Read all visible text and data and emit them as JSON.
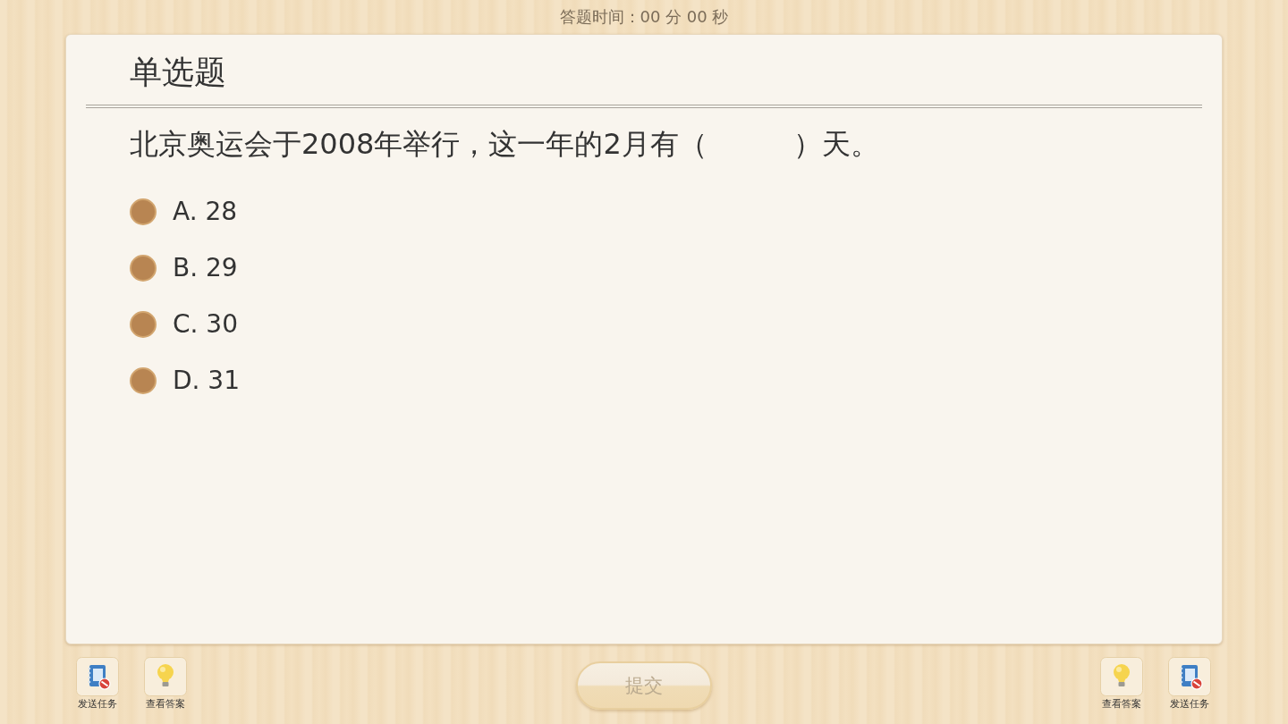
{
  "timer": {
    "text": "答题时间：00 分 00 秒"
  },
  "question": {
    "type_title": "单选题",
    "text": "北京奥运会于2008年举行，这一年的2月有（　　　）天。",
    "options": [
      {
        "label": "A. 28",
        "selected": false
      },
      {
        "label": "B. 29",
        "selected": false
      },
      {
        "label": "C. 30",
        "selected": false
      },
      {
        "label": "D. 31",
        "selected": false
      }
    ]
  },
  "toolbar_left": [
    {
      "kind": "send",
      "label": "发送任务"
    },
    {
      "kind": "answer",
      "label": "查看答案"
    }
  ],
  "submit": {
    "label": "提交",
    "disabled": true
  },
  "toolbar_right": [
    {
      "kind": "answer",
      "label": "查看答案"
    },
    {
      "kind": "send",
      "label": "发送任务"
    }
  ]
}
